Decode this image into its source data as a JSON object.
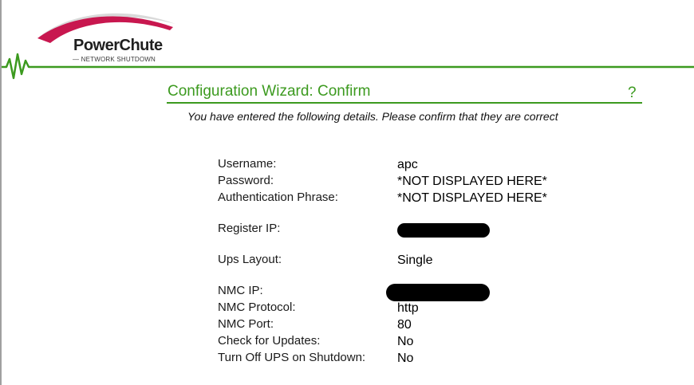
{
  "logo": {
    "brand": "PowerChute",
    "subtitle": "— NETWORK SHUTDOWN",
    "colors": {
      "swoosh": "#c8174f",
      "swoosh_light": "#d9d9d9",
      "accent": "#3c9a1f"
    }
  },
  "wizard": {
    "title": "Configuration Wizard: Confirm",
    "help_label": "?",
    "instructions": "You have entered the following details. Please confirm that they are correct"
  },
  "details": {
    "username_label": "Username:",
    "username_value": "apc",
    "password_label": "Password:",
    "password_value": "*NOT DISPLAYED HERE*",
    "auth_phrase_label": "Authentication Phrase:",
    "auth_phrase_value": "*NOT DISPLAYED HERE*",
    "register_ip_label": "Register IP:",
    "ups_layout_label": "Ups Layout:",
    "ups_layout_value": "Single",
    "nmc_ip_label": "NMC IP:",
    "nmc_protocol_label": "NMC Protocol:",
    "nmc_protocol_value": "http",
    "nmc_port_label": "NMC Port:",
    "nmc_port_value": "80",
    "check_updates_label": "Check for Updates:",
    "check_updates_value": "No",
    "turn_off_ups_label": "Turn Off UPS on Shutdown:",
    "turn_off_ups_value": "No"
  }
}
